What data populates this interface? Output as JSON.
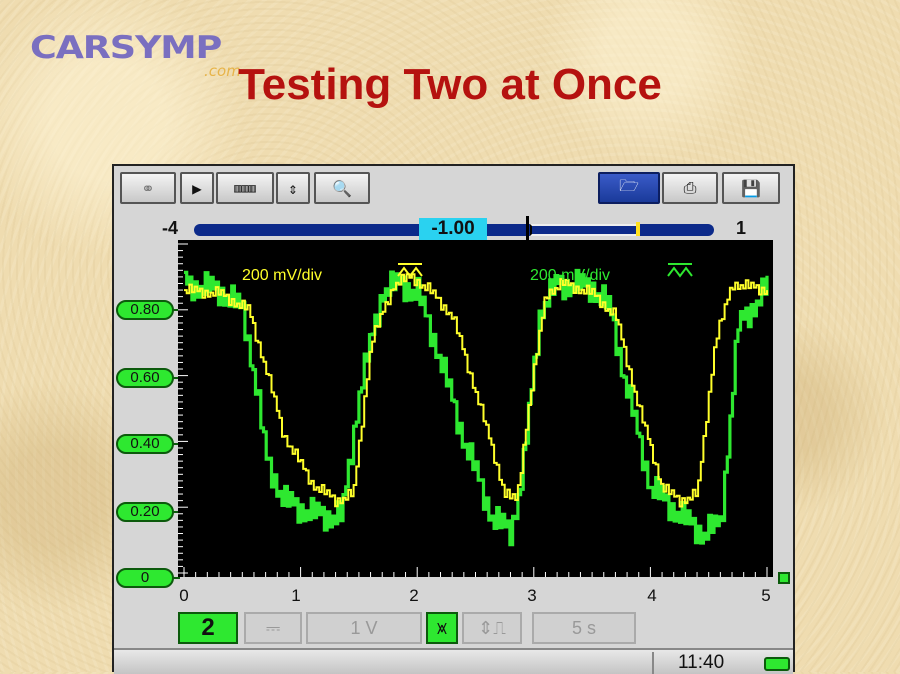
{
  "branding": {
    "logo_text": "CARSYMP",
    "logo_suffix": ".com"
  },
  "slide": {
    "title": "Testing Two at Once"
  },
  "toolbar": {
    "buttons": [
      {
        "icon": "binoculars-icon",
        "glyph": "⚭"
      },
      {
        "icon": "play-icon",
        "glyph": "▶"
      },
      {
        "icon": "filmstrip-icon",
        "glyph": "▥▥▥"
      },
      {
        "icon": "split-arrows-icon",
        "glyph": "⇕"
      },
      {
        "icon": "zoom-icon",
        "glyph": "🔍"
      },
      {
        "icon": "folder-open-icon",
        "glyph": "🗁"
      },
      {
        "icon": "printer-icon",
        "glyph": "⎙"
      },
      {
        "icon": "save-icon",
        "glyph": "💾"
      }
    ]
  },
  "zoom": {
    "left_limit": "-4",
    "right_limit": "1",
    "current": "-1.00"
  },
  "plot": {
    "channel1_label": "200 mV/div",
    "channel2_label": "200 mV/div",
    "channel1_color": "#ffff2a",
    "channel2_color": "#2ee830",
    "background": "#000000"
  },
  "chart_data": {
    "type": "line",
    "x_ticks": [
      "0",
      "1",
      "2",
      "3",
      "4",
      "5"
    ],
    "y_ticks": [
      "0",
      "0.20",
      "0.40",
      "0.60",
      "0.80"
    ],
    "xlim": [
      0,
      5
    ],
    "ylim": [
      0,
      1.0
    ],
    "grid": true,
    "series": [
      {
        "color": "#ffff2a",
        "x": [
          0,
          0.3,
          0.55,
          0.7,
          0.85,
          1.1,
          1.3,
          1.45,
          1.6,
          1.8,
          1.95,
          2.1,
          2.3,
          2.5,
          2.75,
          2.85,
          2.95,
          3.1,
          3.25,
          3.5,
          3.7,
          3.9,
          4.1,
          4.25,
          4.4,
          4.55,
          4.7,
          5
        ],
        "y": [
          0.86,
          0.85,
          0.8,
          0.62,
          0.42,
          0.27,
          0.22,
          0.24,
          0.7,
          0.88,
          0.9,
          0.86,
          0.78,
          0.55,
          0.24,
          0.22,
          0.5,
          0.85,
          0.88,
          0.85,
          0.78,
          0.5,
          0.26,
          0.22,
          0.24,
          0.7,
          0.88,
          0.86
        ]
      },
      {
        "color": "#2ee830",
        "x": [
          0,
          0.3,
          0.5,
          0.6,
          0.7,
          0.85,
          1.1,
          1.35,
          1.5,
          1.7,
          1.85,
          2.0,
          2.15,
          2.4,
          2.65,
          2.8,
          2.9,
          3.05,
          3.2,
          3.5,
          3.65,
          3.8,
          4.0,
          4.3,
          4.45,
          4.6,
          4.75,
          5
        ],
        "y": [
          0.88,
          0.86,
          0.8,
          0.6,
          0.35,
          0.22,
          0.18,
          0.17,
          0.55,
          0.86,
          0.88,
          0.85,
          0.7,
          0.4,
          0.16,
          0.13,
          0.3,
          0.8,
          0.88,
          0.87,
          0.8,
          0.55,
          0.26,
          0.16,
          0.12,
          0.15,
          0.75,
          0.87
        ]
      }
    ]
  },
  "bottom": {
    "channel_number": "2",
    "coupling_icon": "dc-coupling-icon",
    "coupling_glyph": "⎓",
    "volts_per_div": "1 V",
    "trigger_glyph": "⩙",
    "probe_glyph": "⇕⎍",
    "time_base": "5 s"
  },
  "status": {
    "time": "11:40",
    "battery_icon": "battery-icon"
  }
}
